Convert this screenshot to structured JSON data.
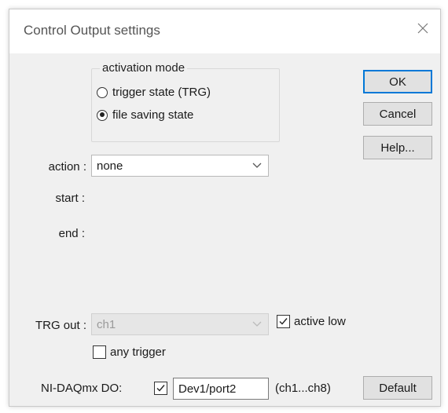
{
  "window": {
    "title": "Control Output settings",
    "close_icon": "close-icon"
  },
  "activation_mode": {
    "legend": "activation mode",
    "options": [
      {
        "label": "trigger state (TRG)",
        "selected": false
      },
      {
        "label": "file saving state",
        "selected": true
      }
    ]
  },
  "buttons": {
    "ok": "OK",
    "cancel": "Cancel",
    "help": "Help...",
    "default": "Default"
  },
  "action": {
    "label": "action :",
    "value": "none"
  },
  "start": {
    "label": "start :"
  },
  "end": {
    "label": "end :"
  },
  "trg_out": {
    "label": "TRG out :",
    "value": "ch1",
    "enabled": false,
    "active_low_label": "active low",
    "active_low_checked": true,
    "any_trigger_label": "any trigger",
    "any_trigger_checked": false
  },
  "nidaq": {
    "label": "NI-DAQmx DO:",
    "checked": true,
    "port_value": "Dev1/port2",
    "range_hint": "(ch1...ch8)"
  },
  "colors": {
    "dialog_bg": "#f0f0f0",
    "button_bg": "#e1e1e1",
    "focus_border": "#0078d7"
  }
}
